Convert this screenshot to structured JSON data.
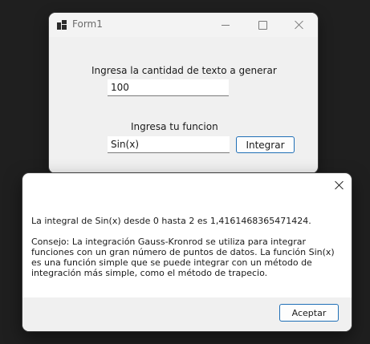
{
  "form": {
    "title": "Form1",
    "count_label": "Ingresa la cantidad de texto a generar",
    "count_value": "100",
    "function_label": "Ingresa tu funcion",
    "function_value": "Sin(x)",
    "integrate_button": "Integrar"
  },
  "message_box": {
    "result_text": "La integral de Sin(x) desde 0 hasta 2 es 1,4161468365471424.",
    "tip_text": "Consejo: La integración Gauss-Kronrod se utiliza para integrar funciones con un gran número de puntos de datos. La función Sin(x) es una función simple que se puede integrar con un método de integración más simple, como el método de trapecio.",
    "ok_button": "Aceptar"
  },
  "icons": {
    "app": "app-window-icon",
    "minimize": "minimize-icon",
    "maximize": "maximize-icon",
    "close": "close-icon"
  },
  "colors": {
    "accent": "#1f6fb6",
    "background": "#1f1f1f",
    "window": "#f0f0f0"
  }
}
